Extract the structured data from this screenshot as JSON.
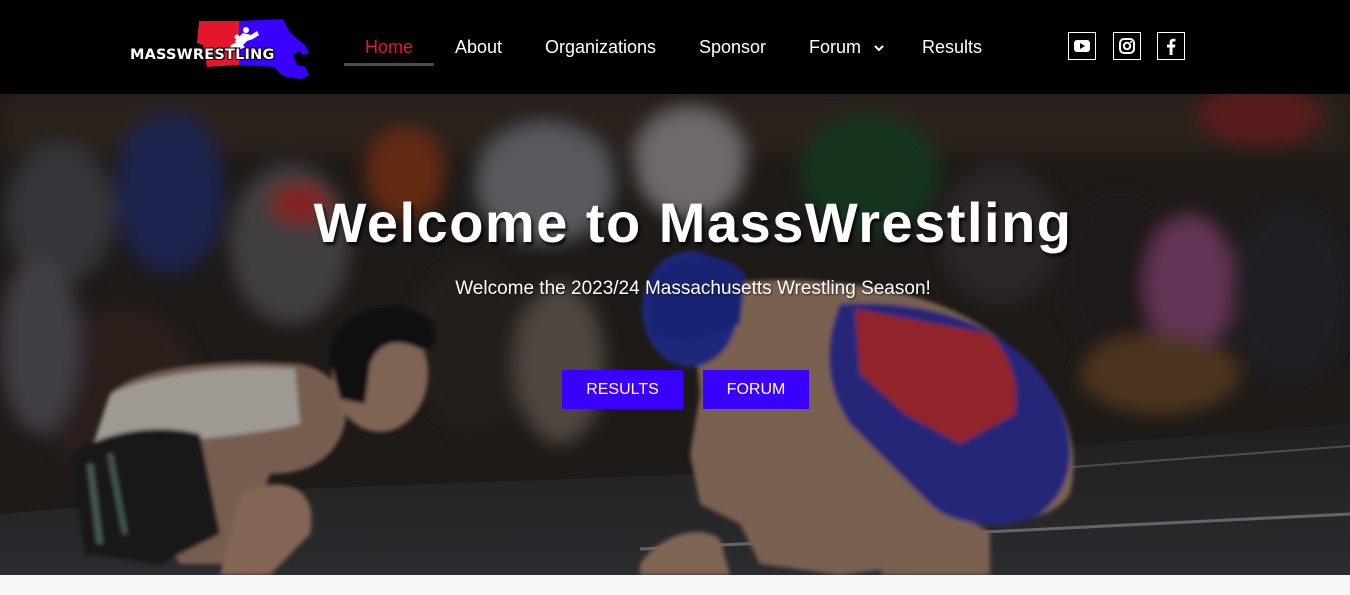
{
  "brand": {
    "logo_text": "MASSWRESTLING",
    "colors": {
      "red": "#e4162c",
      "blue": "#3a00ff",
      "header_bg": "#000000"
    }
  },
  "nav": {
    "items": [
      {
        "label": "Home",
        "active": true
      },
      {
        "label": "About"
      },
      {
        "label": "Organizations"
      },
      {
        "label": "Sponsor"
      },
      {
        "label": "Forum",
        "has_dropdown": true,
        "icon": "chevron-down-icon"
      },
      {
        "label": "Results"
      }
    ]
  },
  "social": {
    "icons": [
      "youtube-icon",
      "instagram-icon",
      "facebook-icon"
    ]
  },
  "hero": {
    "title": "Welcome to MassWrestling",
    "subtitle": "Welcome the 2023/24 Massachusetts Wrestling Season!",
    "buttons": [
      {
        "label": "RESULTS"
      },
      {
        "label": "FORUM"
      }
    ],
    "button_color": "#3a00ff"
  }
}
